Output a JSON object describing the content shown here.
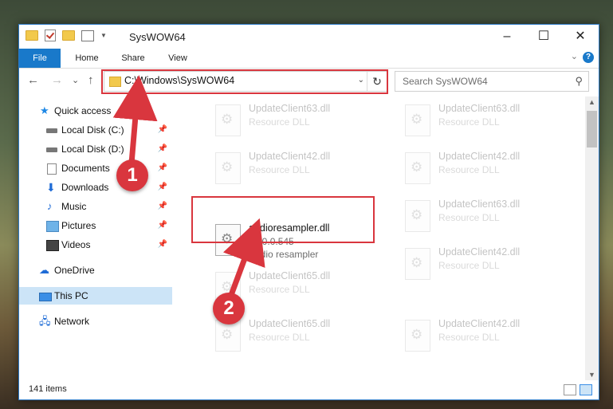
{
  "window": {
    "title": "SysWOW64",
    "minimize": "–",
    "maximize": "☐",
    "close": "✕"
  },
  "ribbon": {
    "tabs": [
      "File",
      "Home",
      "Share",
      "View"
    ],
    "help": "?",
    "expand": "⌄"
  },
  "nav": {
    "back": "←",
    "forward": "→",
    "recent": "⌄",
    "up": "↑",
    "address": "C:\\Windows\\SysWOW64",
    "address_dropdown": "⌄",
    "refresh": "↻",
    "search_placeholder": "Search SysWOW64",
    "search_icon": "⚲"
  },
  "sidebar": {
    "quick_access": "Quick access",
    "items": [
      {
        "label": "Local Disk (C:)",
        "icon": "drive-icon"
      },
      {
        "label": "Local Disk (D:)",
        "icon": "drive-icon"
      },
      {
        "label": "Documents",
        "icon": "documents-icon"
      },
      {
        "label": "Downloads",
        "icon": "download-icon"
      },
      {
        "label": "Music",
        "icon": "music-icon"
      },
      {
        "label": "Pictures",
        "icon": "pictures-icon"
      },
      {
        "label": "Videos",
        "icon": "videos-icon"
      }
    ],
    "pin": "📌",
    "onedrive": "OneDrive",
    "this_pc": "This PC",
    "network": "Network"
  },
  "files": {
    "bg_tiles": [
      {
        "name": "UpdateClient63.dll",
        "desc": "Resource DLL"
      },
      {
        "name": "UpdateClient63.dll",
        "desc": "Resource DLL"
      },
      {
        "name": "UpdateClient42.dll",
        "desc": "Resource DLL"
      },
      {
        "name": "UpdateClient42.dll",
        "desc": "Resource DLL"
      },
      {
        "name": "UpdateClient63.dll",
        "desc": "Resource DLL"
      },
      {
        "name": "UpdateClient65.dll",
        "desc": "Resource DLL"
      },
      {
        "name": "UpdateClient42.dll",
        "desc": "Resource DLL"
      },
      {
        "name": "UpdateClient65.dll",
        "desc": "Resource DLL"
      },
      {
        "name": "UpdateClient42.dll",
        "desc": "Resource DLL"
      }
    ],
    "highlighted": {
      "name": "audioresampler.dll",
      "version": "10.0.0.545",
      "desc": "Audio resampler"
    }
  },
  "status": {
    "count": "141 items"
  },
  "callouts": [
    "1",
    "2"
  ],
  "colors": {
    "accent": "#1979ca",
    "highlight": "#d9363e",
    "selected": "#cce4f7"
  }
}
